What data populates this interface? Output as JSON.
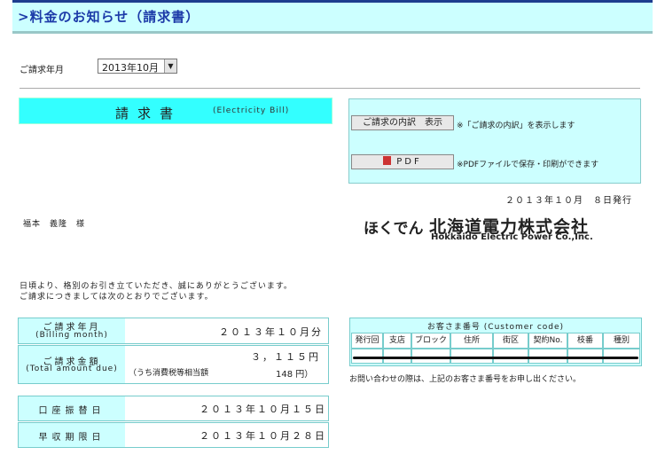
{
  "header": {
    "title": ">料金のお知らせ（請求書）"
  },
  "period_selector": {
    "label": "ご請求年月",
    "selected": "2013年10月"
  },
  "bill": {
    "title": "請求書",
    "subtitle": "(Electricity Bill)"
  },
  "actions": {
    "detail_button": "ご請求の内訳　表示",
    "detail_note": "※「ご請求の内訳」を表示します",
    "pdf_button": "PDF",
    "pdf_note": "※PDFファイルで保存・印刷ができます"
  },
  "issue_date": "２０１３年１０月　８日発行",
  "customer_name": "福本　義隆　様",
  "company": {
    "logo_hiragana": "ほくでん",
    "logo_kanji": "北海道電力株式会社",
    "logo_english": "Hokkaido Electric Power Co.,Inc."
  },
  "greeting": {
    "line1": "日頃より、格別のお引き立ていただき、誠にありがとうございます。",
    "line2": "ご請求につきましては次のとおりでございます。"
  },
  "billing": {
    "period_label": "ご請求年月",
    "period_label_en": "(Billing month)",
    "period_value": "２０１３年１０月分",
    "amount_label": "ご請求金額",
    "amount_label_en": "(Total amount due)",
    "amount_value": "３，１１５円",
    "tax_label": "（うち消費税等相当額",
    "tax_value": "148 円）",
    "debit_label": "口座振替日",
    "debit_value": "２０１３年１０月１５日",
    "due_label": "早収期限日",
    "due_value": "２０１３年１０月２８日"
  },
  "customer_code": {
    "title": "お客さま番号 (Customer code)",
    "headers": [
      "発行回",
      "支店",
      "ブロック",
      "住所",
      "街区",
      "契約No.",
      "枝番",
      "種別"
    ],
    "note": "お問い合わせの際は、上記のお客さま番号をお申し出ください。"
  }
}
